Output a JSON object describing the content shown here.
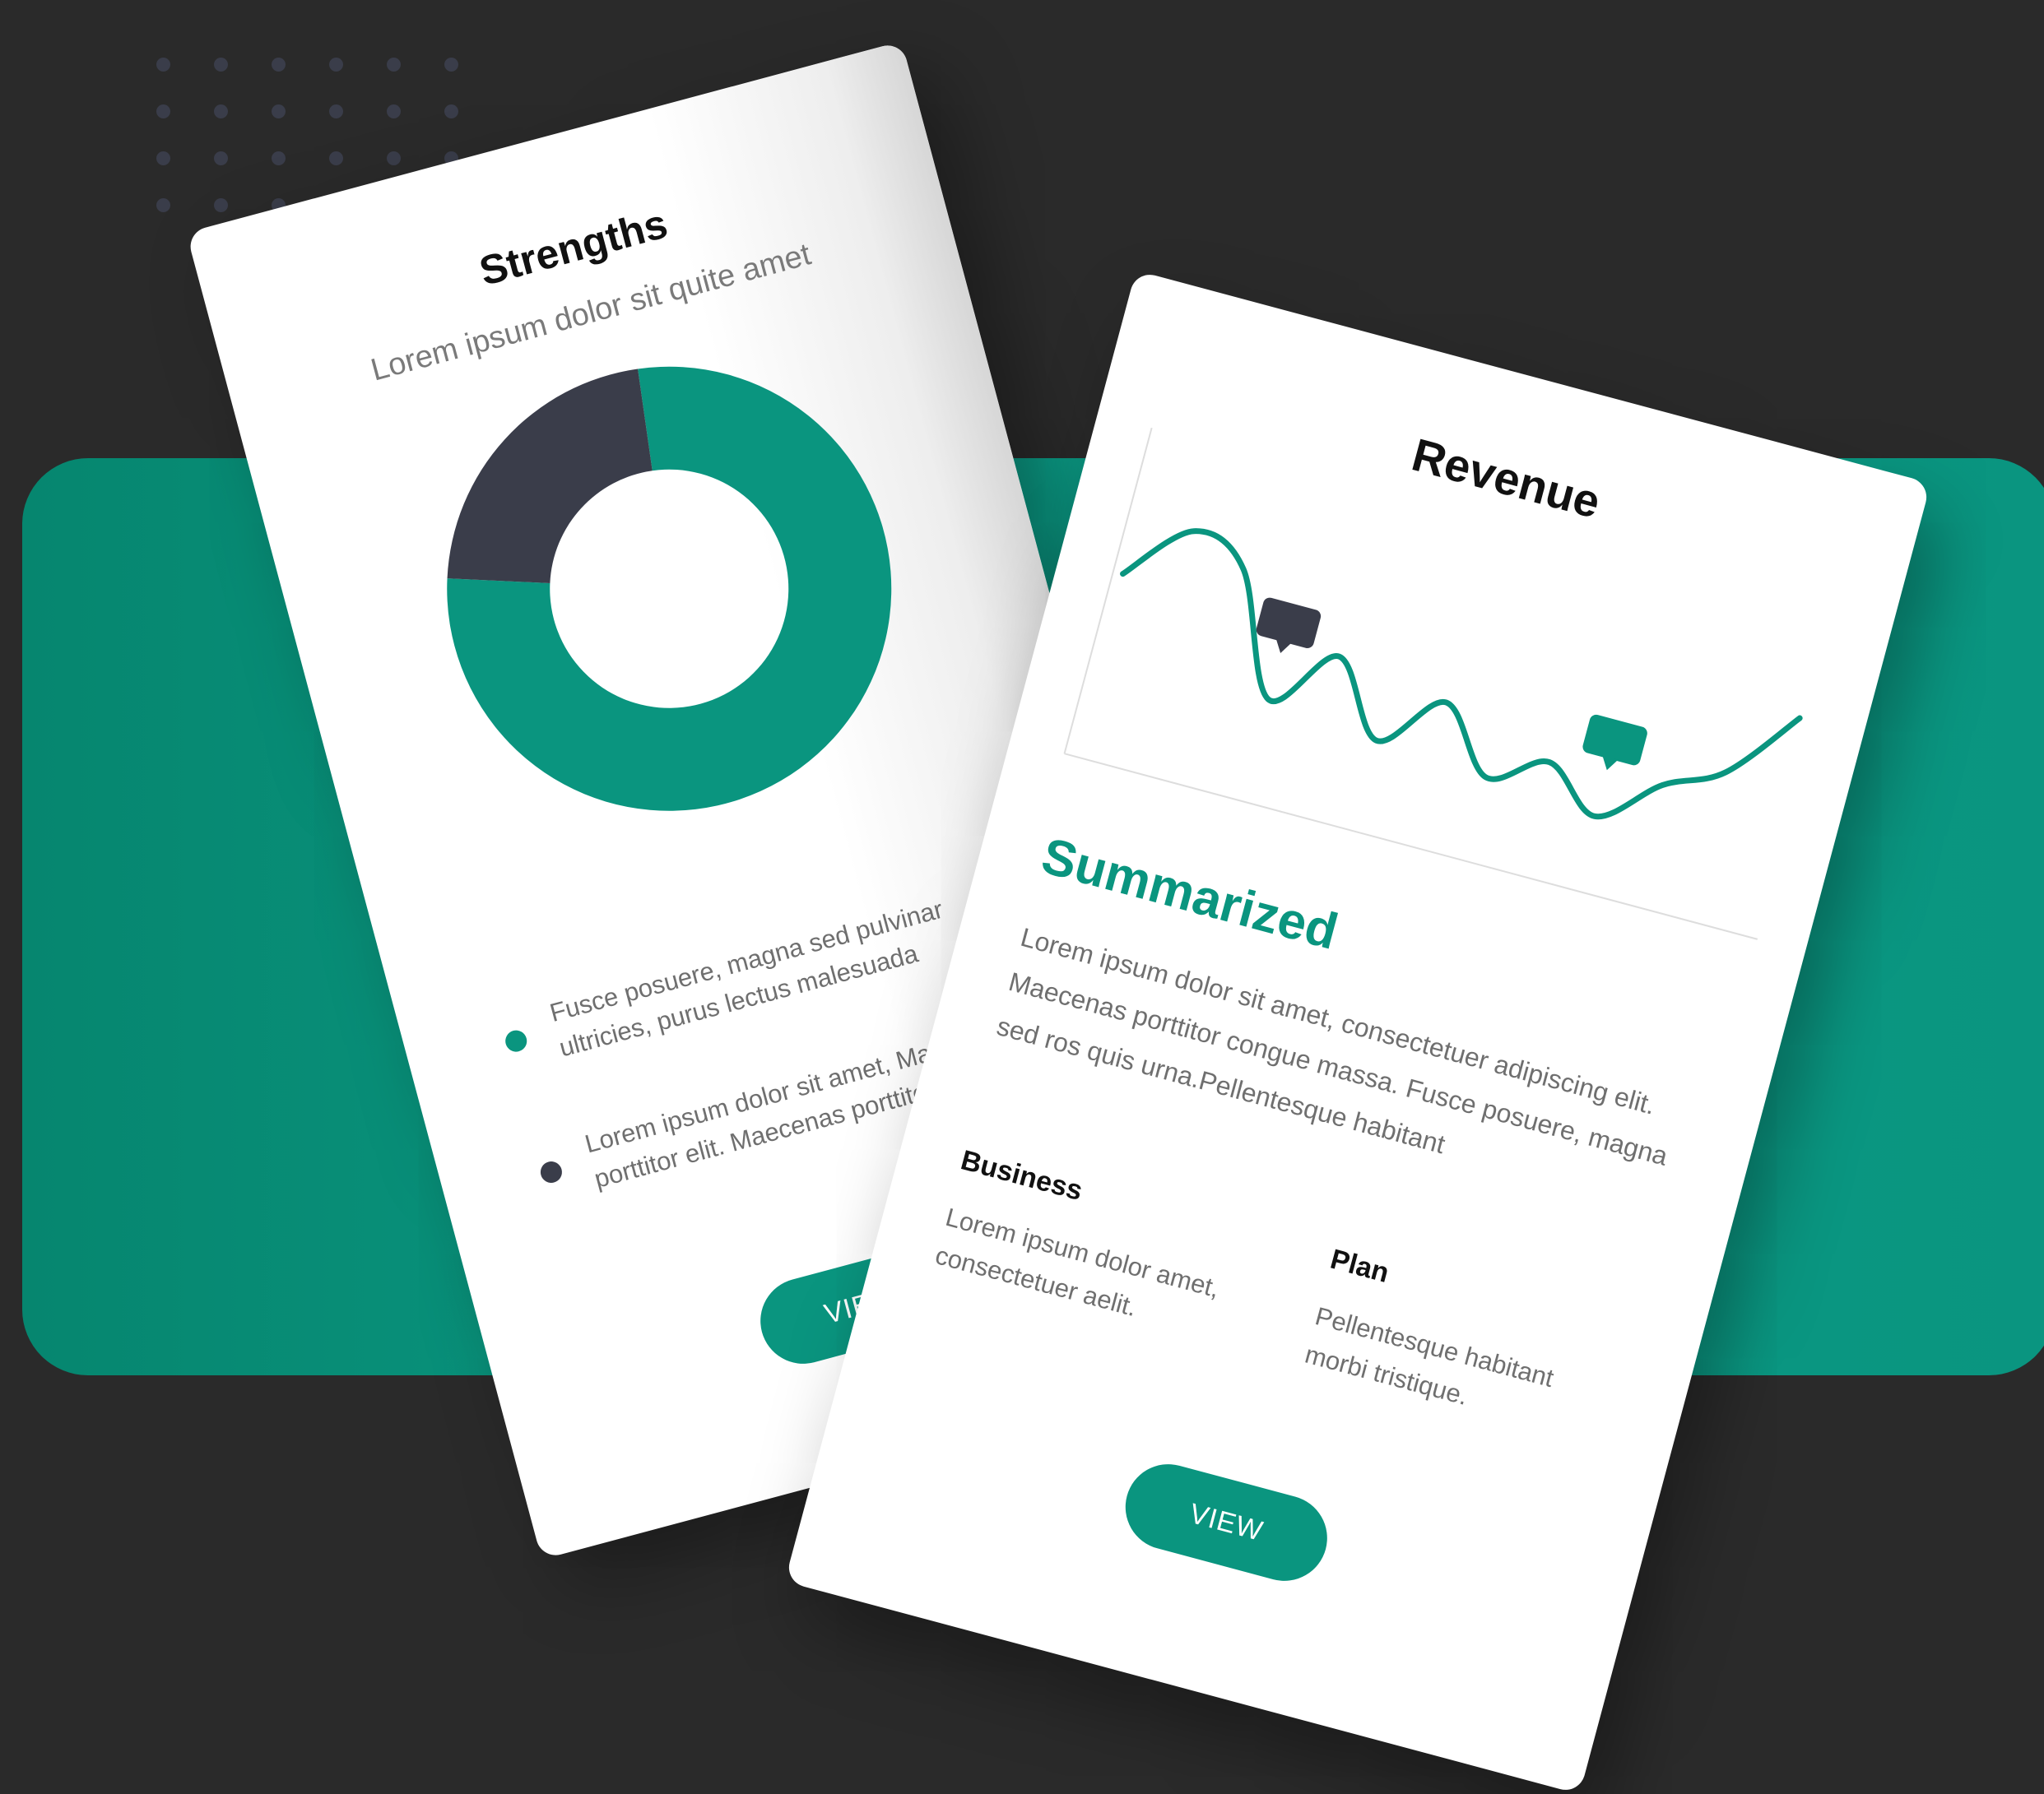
{
  "colors": {
    "background": "#2a2a2a",
    "accent": "#0a957f",
    "dark_slate": "#3a3d4a",
    "white": "#ffffff",
    "muted_text": "#6f6f6f"
  },
  "strengths_card": {
    "title": "Strengths",
    "subtitle": "Lorem ipsum dolor sit quite amet",
    "chart_data": {
      "type": "pie",
      "title": "",
      "slices": [
        {
          "value": 78,
          "color": "#0a957f"
        },
        {
          "value": 22,
          "color": "#3a3d4a"
        }
      ]
    },
    "legend": [
      {
        "text": "Fusce posuere, magna sed pulvinar ultricies, purus lectus malesuada",
        "bullet_color": "#0a957f",
        "bullet_icon": "teal-dot-icon"
      },
      {
        "text": "Lorem ipsum dolor sit amet, Maecenas porttitor elit. Maecenas porttitor",
        "bullet_color": "#3a3d4a",
        "bullet_icon": "slate-dot-icon"
      }
    ],
    "view_label": "VIEW"
  },
  "revenue_card": {
    "title": "Revenue",
    "chart_data": {
      "type": "line",
      "title": "",
      "xlabel": "",
      "ylabel": "",
      "grid": false,
      "x": [
        0,
        1,
        2,
        3,
        4,
        5,
        6,
        7,
        8,
        9,
        10,
        11,
        12
      ],
      "series": [
        {
          "values": [
            55,
            80,
            70,
            20,
            45,
            15,
            38,
            12,
            25,
            8,
            28,
            40,
            70
          ],
          "color": "#0a957f"
        }
      ],
      "markers": [
        {
          "icon": "comment-icon",
          "color": "#3a3d4a"
        },
        {
          "icon": "comment-icon",
          "color": "#0a957f"
        }
      ]
    },
    "heading": "Summarized",
    "body": "Lorem ipsum dolor sit amet, consectetuer adipiscing elit. Maecenas porttitor congue massa. Fusce posuere, magna sed ros quis urna.Pellentesque habitant",
    "columns": [
      {
        "title": "Business",
        "text": "Lorem ipsum dolor amet, consectetuer aelit."
      },
      {
        "title": "Plan",
        "text": "Pellentesque habitant morbi tristique."
      }
    ],
    "view_label": "VIEW"
  }
}
